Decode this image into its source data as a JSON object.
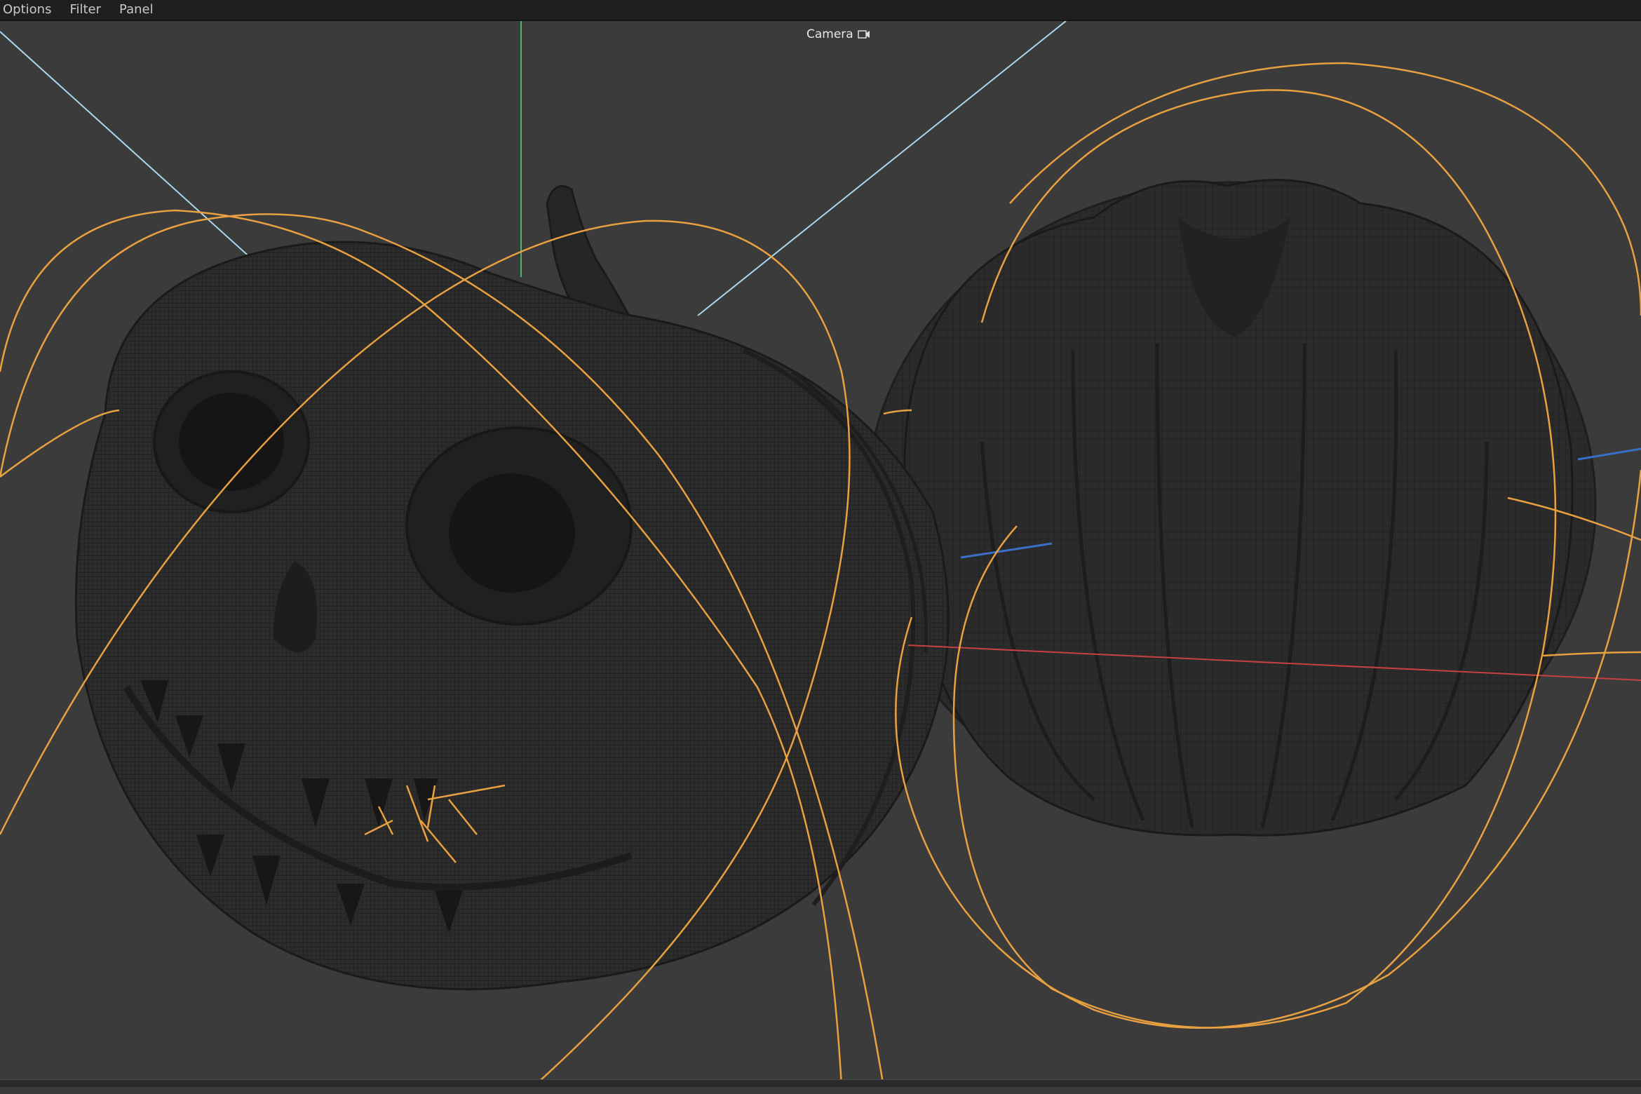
{
  "menubar": {
    "items": [
      "Options",
      "Filter",
      "Panel"
    ]
  },
  "viewport": {
    "camera_label": "Camera",
    "camera_icon": "camera-icon"
  },
  "colors": {
    "background": "#3b3b3b",
    "menubar": "#1f1f1f",
    "wire_orange": "#e8a040",
    "axis_green": "#4fb36a",
    "axis_cyan": "#a9d8ee",
    "axis_red": "#c94040",
    "axis_blue": "#3a6fc8",
    "mesh": "#262626"
  },
  "objects": [
    "carved-jack-o-lantern",
    "plain-pumpkin"
  ]
}
